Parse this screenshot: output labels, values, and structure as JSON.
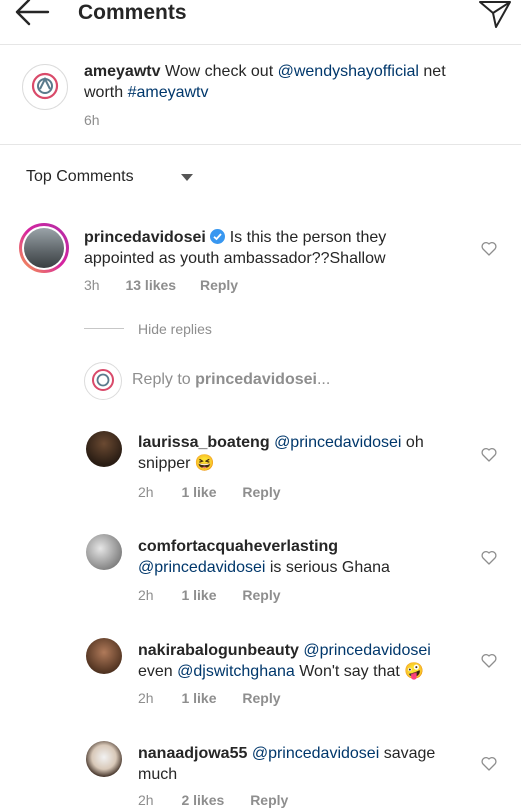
{
  "header": {
    "title": "Comments",
    "back_icon": "arrow-left-icon",
    "send_icon": "paper-plane-icon"
  },
  "post": {
    "username": "ameyawtv",
    "text_1": " Wow check out ",
    "mention": "@wendyshayofficial",
    "text_2": " net",
    "text_3": "worth ",
    "hashtag": "#ameyawtv",
    "time": "6h"
  },
  "sort": {
    "label": "Top Comments"
  },
  "comment": {
    "username": "princedavidosei",
    "text_1": "Is this the person they",
    "text_2": "appointed  as youth ambassador??Shallow",
    "time": "3h",
    "likes": "13 likes",
    "reply": "Reply"
  },
  "hide_replies": "Hide replies",
  "reply_input": {
    "placeholder_prefix": "Reply to ",
    "placeholder_user": "princedavidosei",
    "placeholder_suffix": "..."
  },
  "replies": [
    {
      "username": "laurissa_boateng",
      "mention": "@princedavidosei",
      "text_1": " oh",
      "text_2": "snipper ",
      "emoji": "😆",
      "time": "2h",
      "likes": "1 like",
      "reply": "Reply"
    },
    {
      "username": "comfortacquaheverlasting",
      "mention": "@princedavidosei",
      "text_1": " is serious Ghana",
      "time": "2h",
      "likes": "1 like",
      "reply": "Reply"
    },
    {
      "username": "nakirabalogunbeauty",
      "mention": "@princedavidosei",
      "text_1": "even ",
      "mention_2": "@djswitchghana",
      "text_2": "  Won't say that ",
      "emoji": "🤪",
      "time": "2h",
      "likes": "1 like",
      "reply": "Reply"
    },
    {
      "username": "nanaadjowa55",
      "mention": "@princedavidosei",
      "text_1": " savage",
      "text_2": "much",
      "time": "2h",
      "likes": "2 likes",
      "reply": "Reply"
    }
  ],
  "colors": {
    "text": "#262626",
    "link": "#00376b",
    "meta": "#8e8e8e",
    "verified": "#3897f0",
    "divider": "#e6e6e6"
  }
}
